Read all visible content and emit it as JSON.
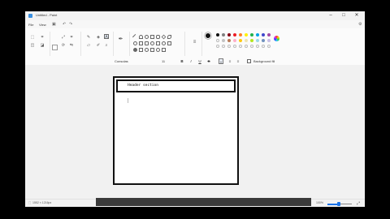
{
  "window": {
    "title": "Untitled - Paint",
    "minimize": "–",
    "maximize": "□",
    "close": "✕"
  },
  "menu": {
    "file": "File",
    "view": "View"
  },
  "ribbon": {
    "groups": {
      "selection": "Selection",
      "image": "Image",
      "tools": "Tools",
      "brushes": "Brushes",
      "shapes": "Shapes",
      "size": "Size",
      "colours": "Colours"
    }
  },
  "text_toolbar": {
    "font": "Consolas",
    "size": "11",
    "bold": "B",
    "italic": "I",
    "underline": "U",
    "strike": "S",
    "align": "≡",
    "background_fill": "Background fill"
  },
  "canvas": {
    "header_text": "Header section"
  },
  "status": {
    "dimensions": "1552 × 1216px",
    "zoom": "100%"
  },
  "colors": {
    "accent": "#1a73e8",
    "primary_color": "#111111",
    "palette": [
      "#111111",
      "#7f7f7f",
      "#880015",
      "#ed1c24",
      "#ff7f27",
      "#fff200",
      "#22b14c",
      "#00a2e8",
      "#3f48cc",
      "#a349a4",
      "#c3c3c3",
      "#b97a57"
    ]
  }
}
